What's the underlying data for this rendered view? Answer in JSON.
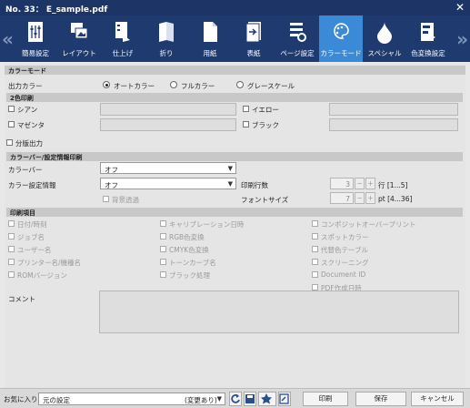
{
  "window": {
    "title": "No. 33： E_sample.pdf",
    "close": "✕"
  },
  "tabs": [
    {
      "label": "簡易設定",
      "icon": "quick-settings-icon"
    },
    {
      "label": "レイアウト",
      "icon": "layout-icon"
    },
    {
      "label": "仕上げ",
      "icon": "finishing-icon"
    },
    {
      "label": "折り",
      "icon": "fold-icon"
    },
    {
      "label": "用紙",
      "icon": "paper-icon"
    },
    {
      "label": "表紙",
      "icon": "cover-icon"
    },
    {
      "label": "ページ設定",
      "icon": "page-settings-icon"
    },
    {
      "label": "カラーモード",
      "icon": "palette-icon"
    },
    {
      "label": "スペシャル",
      "icon": "drop-icon"
    },
    {
      "label": "色変換設定",
      "icon": "color-conversion-icon"
    }
  ],
  "nav": {
    "prev": "«",
    "next": "»"
  },
  "color_mode": {
    "header": "カラーモード",
    "output_label": "出力カラー",
    "options": [
      "オートカラー",
      "フルカラー",
      "グレースケール"
    ],
    "selected": "オートカラー"
  },
  "two_color": {
    "header": "2色印刷",
    "items": [
      "シアン",
      "イエロー",
      "マゼンタ",
      "ブラック"
    ]
  },
  "separation": "分版出力",
  "colorbar": {
    "header": "カラーバー/設定情報印刷",
    "bar_label": "カラーバー",
    "bar_value": "オフ",
    "info_label": "カラー設定情報",
    "info_value": "オフ",
    "bg_trans": "背景透過",
    "lines_label": "印刷行数",
    "lines_value": "3",
    "lines_unit": "行 [1...5]",
    "font_label": "フォントサイズ",
    "font_value": "7",
    "font_unit": "pt [4...36]",
    "minus": "−",
    "plus": "+"
  },
  "print_items": {
    "header": "印刷項目",
    "col1": [
      "日付/時刻",
      "ジョブ名",
      "ユーザー名",
      "プリンター名/機種名",
      "ROMバージョン"
    ],
    "col2": [
      "キャリブレーション日時",
      "RGB色変換",
      "CMYK色変換",
      "トーンカーブ名",
      "ブラック処理"
    ],
    "col3": [
      "コンポジットオーバープリント",
      "スポットカラー",
      "代替色テーブル",
      "スクリーニング",
      "Document ID",
      "PDF作成日時"
    ],
    "comment_label": "コメント"
  },
  "footer": {
    "fav_label": "お気に入り",
    "fav_value": "元の設定",
    "fav_status": "(変更あり)",
    "print": "印刷",
    "save": "保存",
    "cancel": "キャンセル"
  },
  "colors": {
    "title_bg": "#1c3566",
    "tab_bg": "#1f3a6e",
    "tab_active": "#3a8ad8"
  }
}
